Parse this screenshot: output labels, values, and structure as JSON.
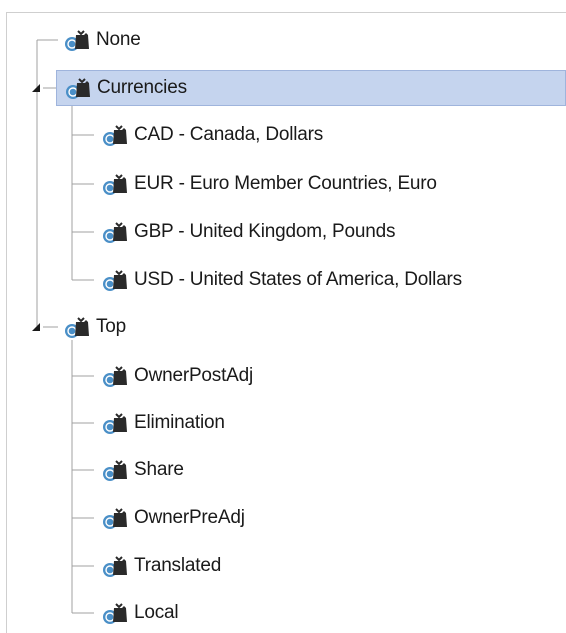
{
  "tree": {
    "none": {
      "label": "None",
      "icon": "money-bag-icon"
    },
    "currencies": {
      "label": "Currencies",
      "icon": "money-bag-icon",
      "expanded": true,
      "selected": true,
      "children": [
        {
          "label": "CAD - Canada, Dollars",
          "icon": "money-bag-icon"
        },
        {
          "label": "EUR - Euro Member Countries, Euro",
          "icon": "money-bag-icon"
        },
        {
          "label": "GBP - United Kingdom, Pounds",
          "icon": "money-bag-icon"
        },
        {
          "label": "USD - United States of America, Dollars",
          "icon": "money-bag-icon"
        }
      ]
    },
    "top": {
      "label": "Top",
      "icon": "money-bag-icon",
      "expanded": true,
      "children": [
        {
          "label": "OwnerPostAdj",
          "icon": "money-bag-icon"
        },
        {
          "label": "Elimination",
          "icon": "money-bag-icon"
        },
        {
          "label": "Share",
          "icon": "money-bag-icon"
        },
        {
          "label": "OwnerPreAdj",
          "icon": "money-bag-icon"
        },
        {
          "label": "Translated",
          "icon": "money-bag-icon"
        },
        {
          "label": "Local",
          "icon": "money-bag-icon"
        }
      ]
    }
  },
  "colors": {
    "selection_bg": "#c5d4ee",
    "selection_border": "#9fb4dc",
    "tree_line": "#a0a0a0",
    "icon_bag": "#2a2a2a",
    "icon_coin": "#4a8fc7"
  }
}
